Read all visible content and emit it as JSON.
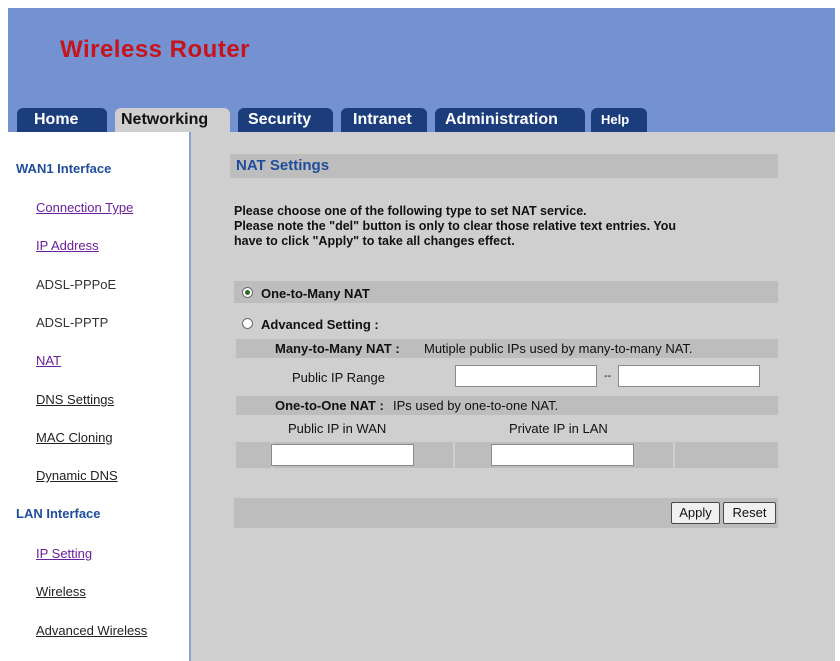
{
  "header": {
    "brand": "Wireless Router"
  },
  "tabs": [
    {
      "label": "Home"
    },
    {
      "label": "Networking"
    },
    {
      "label": "Security"
    },
    {
      "label": "Intranet"
    },
    {
      "label": "Administration"
    },
    {
      "label": "Help"
    }
  ],
  "sidebar": {
    "wan_title": "WAN1 Interface",
    "wan_items": [
      {
        "label": "Connection Type"
      },
      {
        "label": "IP Address"
      },
      {
        "label": "ADSL-PPPoE"
      },
      {
        "label": "ADSL-PPTP"
      },
      {
        "label": "NAT"
      },
      {
        "label": "DNS Settings"
      },
      {
        "label": "MAC Cloning"
      },
      {
        "label": "Dynamic DNS"
      }
    ],
    "lan_title": "LAN Interface",
    "lan_items": [
      {
        "label": "IP Setting"
      },
      {
        "label": "Wireless"
      },
      {
        "label": "Advanced Wireless"
      }
    ]
  },
  "main": {
    "title": "NAT Settings",
    "instruction_1": "Please choose one of the following type to set NAT service.",
    "instruction_2": "Please note the \"del\" button is only to clear those relative text entries. You",
    "instruction_3": "have to click \"Apply\" to take all changes effect.",
    "option_one_to_many": "One-to-Many NAT",
    "option_advanced": "Advanced Setting :",
    "selected_option": "One-to-Many NAT",
    "many_to_many_label": "Many-to-Many NAT :",
    "many_to_many_desc": "Mutiple public IPs used by many-to-many NAT.",
    "public_ip_range_label": "Public IP Range",
    "range_separator": "--",
    "one_to_one_label": "One-to-One NAT :",
    "one_to_one_desc": "IPs used by one-to-one NAT.",
    "col_public_ip_wan": "Public IP in WAN",
    "col_private_ip_lan": "Private IP in LAN",
    "range_start_value": "",
    "range_end_value": "",
    "public_ip_value": "",
    "private_ip_value": "",
    "apply_label": "Apply",
    "reset_label": "Reset"
  }
}
